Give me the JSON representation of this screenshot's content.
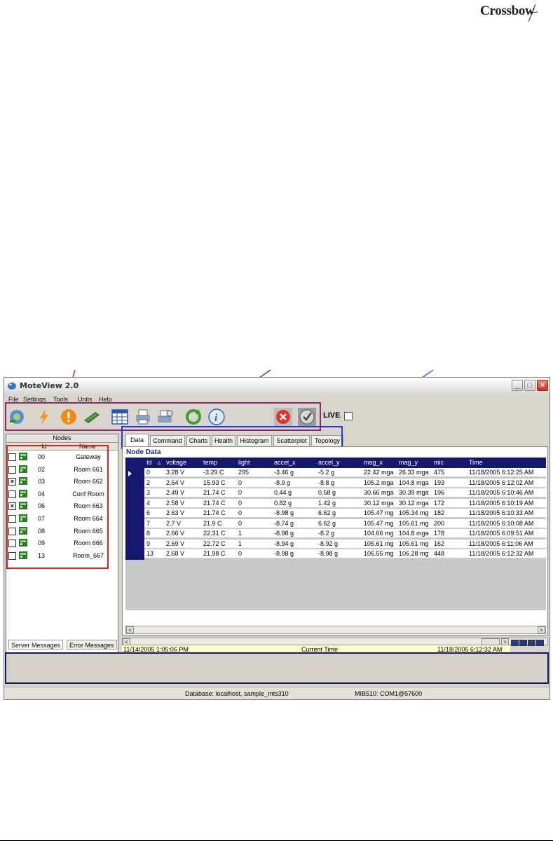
{
  "brand": {
    "logo_text": "Crossbow"
  },
  "window": {
    "title": "MoteView 2.0",
    "menu": [
      "File",
      "Settings",
      "Tools",
      "Units",
      "Help"
    ],
    "live_label": "LIVE"
  },
  "nodes_panel": {
    "header": "Nodes",
    "col_id": "Id",
    "col_name": "Name",
    "rows": [
      {
        "id": "00",
        "name": "Gateway",
        "checked": false
      },
      {
        "id": "02",
        "name": "Room 661",
        "checked": false
      },
      {
        "id": "03",
        "name": "Room 662",
        "checked": true
      },
      {
        "id": "04",
        "name": "Conf Room",
        "checked": false
      },
      {
        "id": "06",
        "name": "Room 663",
        "checked": true
      },
      {
        "id": "07",
        "name": "Room 664",
        "checked": false
      },
      {
        "id": "08",
        "name": "Room 665",
        "checked": false
      },
      {
        "id": "09",
        "name": "Room 666",
        "checked": false
      },
      {
        "id": "13",
        "name": "Room_667",
        "checked": false
      }
    ]
  },
  "tabs": [
    "Data",
    "Command",
    "Charts",
    "Health",
    "Histogram",
    "Scatterplot",
    "Topology"
  ],
  "node_data": {
    "title": "Node Data",
    "columns": [
      "Id",
      "voltage",
      "temp",
      "light",
      "accel_x",
      "accel_y",
      "mag_x",
      "mag_y",
      "mic",
      "Time"
    ],
    "rows": [
      [
        "0",
        "3.28 V",
        "-3.29 C",
        "295",
        "-3.46 g",
        "-5.2 g",
        "22.42 mga",
        "26.33 mga",
        "475",
        "11/18/2005 6:12:25 AM"
      ],
      [
        "2",
        "2.64 V",
        "15.93 C",
        "0",
        "-8.9 g",
        "-8.8 g",
        "105.2 mga",
        "104.8 mga",
        "193",
        "11/18/2005 6:12:02 AM"
      ],
      [
        "3",
        "2.49 V",
        "21.74 C",
        "0",
        "0.44 g",
        "0.58 g",
        "30.66 mga",
        "30.39 mga",
        "196",
        "11/18/2005 6:10:46 AM"
      ],
      [
        "4",
        "2.58 V",
        "21.74 C",
        "0",
        "0.82 g",
        "1.42 g",
        "30.12 mga",
        "30.12 mga",
        "172",
        "11/18/2005 6:10:19 AM"
      ],
      [
        "6",
        "2.63 V",
        "21.74 C",
        "0",
        "-8.98 g",
        "6.62 g",
        "105.47 mg",
        "105.34 mg",
        "182",
        "11/18/2005 6:10:33 AM"
      ],
      [
        "7",
        "2.7 V",
        "21.9 C",
        "0",
        "-8.74 g",
        "6.62 g",
        "105.47 mg",
        "105.61 mg",
        "200",
        "11/18/2005 6:10:08 AM"
      ],
      [
        "8",
        "2.66 V",
        "22.31 C",
        "1",
        "-8.98 g",
        "-8.2 g",
        "104.66 mg",
        "104.8 mga",
        "178",
        "11/18/2005 6:09:51 AM"
      ],
      [
        "9",
        "2.69 V",
        "22.72 C",
        "1",
        "-8.94 g",
        "-8.92 g",
        "105.61 mg",
        "105.61 mg",
        "162",
        "11/18/2005 6:11:06 AM"
      ],
      [
        "13",
        "2.68 V",
        "21.98 C",
        "0",
        "-8.98 g",
        "-8.98 g",
        "106.55 mg",
        "106.28 mg",
        "448",
        "11/18/2005 6:12:32 AM"
      ]
    ]
  },
  "timeline": {
    "start": "11/14/2005 1:05:06 PM",
    "label": "Current Time",
    "end": "11/18/2005 6:12:32 AM"
  },
  "messages": {
    "tab_server": "Server Messages",
    "tab_error": "Error Messages"
  },
  "status": {
    "database": "Database: localhost, sample_mts310",
    "port": "MIB510: COM1@57600"
  },
  "colors": {
    "grid_header": "#15196e",
    "anno_red": "#e2211c",
    "anno_purple": "#8c2a6e",
    "anno_blue": "#2a3ad0"
  }
}
